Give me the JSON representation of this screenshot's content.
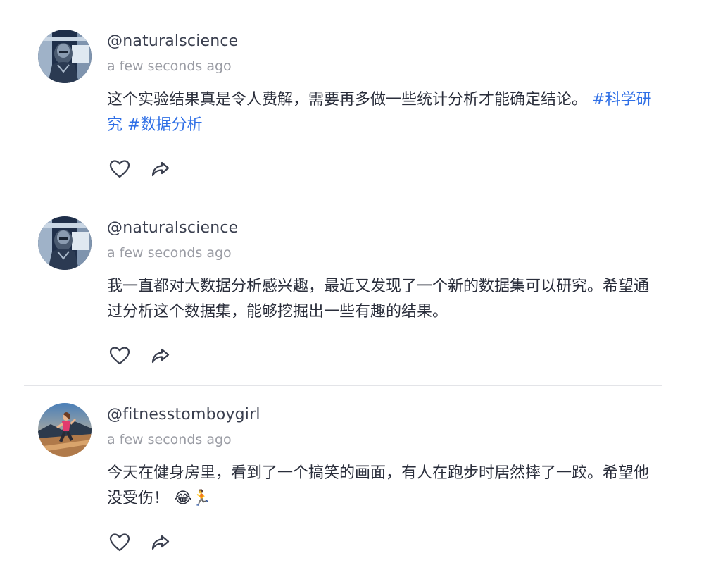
{
  "posts": [
    {
      "handle": "@naturalscience",
      "time": "a few seconds ago",
      "text": "这个实验结果真是令人费解，需要再多做一些统计分析才能确定结论。",
      "tags": [
        "#科学研究",
        "#数据分析"
      ],
      "avatar": "robot-scientist-avatar"
    },
    {
      "handle": "@naturalscience",
      "time": "a few seconds ago",
      "text": "我一直都对大数据分析感兴趣，最近又发现了一个新的数据集可以研究。希望通过分析这个数据集，能够挖掘出一些有趣的结果。",
      "avatar": "robot-scientist-avatar"
    },
    {
      "handle": "@fitnesstomboygirl",
      "time": "a few seconds ago",
      "text": "今天在健身房里，看到了一个搞笑的画面，有人在跑步时居然摔了一跤。希望他没受伤！",
      "emojis": [
        "😂",
        "🏃"
      ],
      "avatar": "runner-girl-avatar"
    }
  ],
  "icons": {
    "like": "heart-icon",
    "share": "share-icon"
  },
  "colors": {
    "tag": "#2f6fe6",
    "divider": "#e3e4e8",
    "muted": "#9a9ca4"
  }
}
